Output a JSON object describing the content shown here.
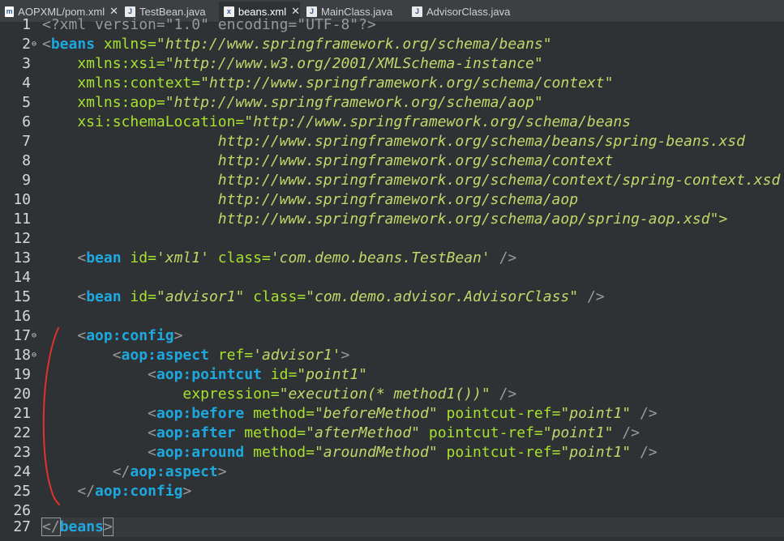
{
  "tabs": [
    {
      "label": "AOPXML/pom.xml",
      "icon": "maven-icon",
      "close": "✕"
    },
    {
      "label": "TestBean.java",
      "icon": "java-file-icon"
    },
    {
      "label": "beans.xml",
      "icon": "xml-file-icon",
      "close": "✕"
    },
    {
      "label": "MainClass.java",
      "icon": "java-file-icon"
    },
    {
      "label": "AdvisorClass.java",
      "icon": "java-file-icon"
    }
  ],
  "line_numbers": [
    "1",
    "2",
    "3",
    "4",
    "5",
    "6",
    "7",
    "8",
    "9",
    "10",
    "11",
    "12",
    "13",
    "14",
    "15",
    "16",
    "17",
    "18",
    "19",
    "20",
    "21",
    "22",
    "23",
    "24",
    "25",
    "26",
    "27"
  ],
  "code": {
    "l1": "<?xml version=\"1.0\" encoding=\"UTF-8\"?>",
    "l2": {
      "open": "<",
      "tag": "beans",
      "attr": " xmlns=",
      "val": "\"http://www.springframework.org/schema/beans\""
    },
    "l3": {
      "attr": "    xmlns:xsi=",
      "val": "\"http://www.w3.org/2001/XMLSchema-instance\""
    },
    "l4": {
      "attr": "    xmlns:context=",
      "val": "\"http://www.springframework.org/schema/context\""
    },
    "l5": {
      "attr": "    xmlns:aop=",
      "val": "\"http://www.springframework.org/schema/aop\""
    },
    "l6": {
      "attr": "    xsi:schemaLocation=",
      "val": "\"http://www.springframework.org/schema/beans"
    },
    "l7": "                    http://www.springframework.org/schema/beans/spring-beans.xsd",
    "l8": "                    http://www.springframework.org/schema/context",
    "l9": "                    http://www.springframework.org/schema/context/spring-context.xsd",
    "l10": "                    http://www.springframework.org/schema/aop",
    "l11": "                    http://www.springframework.org/schema/aop/spring-aop.xsd\">",
    "l13": {
      "indent": "    ",
      "open": "<",
      "tag": "bean",
      "a1": " id=",
      "v1": "'xml1'",
      "a2": " class=",
      "v2": "'com.demo.beans.TestBean'",
      "close": " />"
    },
    "l15": {
      "indent": "    ",
      "open": "<",
      "tag": "bean",
      "a1": " id=",
      "v1": "\"advisor1\"",
      "a2": " class=",
      "v2": "\"com.demo.advisor.AdvisorClass\"",
      "close": " />"
    },
    "l17": {
      "indent": "    ",
      "open": "<",
      "tag": "aop:config",
      "close": ">"
    },
    "l18": {
      "indent": "        ",
      "open": "<",
      "tag": "aop:aspect",
      "a1": " ref=",
      "v1": "'advisor1'",
      "close": ">"
    },
    "l19": {
      "indent": "            ",
      "open": "<",
      "tag": "aop:pointcut",
      "a1": " id=",
      "v1": "\"point1\""
    },
    "l20": {
      "indent": "                ",
      "a1": "expression=",
      "v1": "\"execution(* method1())\"",
      "close": " />"
    },
    "l21": {
      "indent": "            ",
      "open": "<",
      "tag": "aop:before",
      "a1": " method=",
      "v1": "\"beforeMethod\"",
      "a2": " pointcut-ref=",
      "v2": "\"point1\"",
      "close": " />"
    },
    "l22": {
      "indent": "            ",
      "open": "<",
      "tag": "aop:after",
      "a1": " method=",
      "v1": "\"afterMethod\"",
      "a2": " pointcut-ref=",
      "v2": "\"point1\"",
      "close": " />"
    },
    "l23": {
      "indent": "            ",
      "open": "<",
      "tag": "aop:around",
      "a1": " method=",
      "v1": "\"aroundMethod\"",
      "a2": " pointcut-ref=",
      "v2": "\"point1\"",
      "close": " />"
    },
    "l24": {
      "indent": "        ",
      "open": "</",
      "tag": "aop:aspect",
      "close": ">"
    },
    "l25": {
      "indent": "    ",
      "open": "</",
      "tag": "aop:config",
      "close": ">"
    },
    "l27": {
      "open": "</",
      "tag": "beans",
      "close": ">"
    }
  },
  "colors": {
    "tag": "#1ea8e0",
    "attribute": "#a6e22e",
    "value": "#c0d86a",
    "annotation": "#e0322f"
  }
}
